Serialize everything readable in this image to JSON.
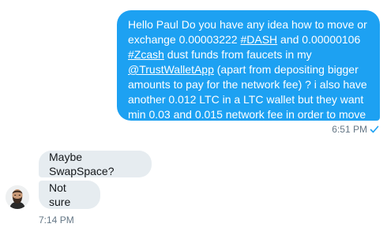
{
  "conversation": {
    "outgoing": {
      "segments": [
        {
          "text": "Hello Paul Do you have any idea how to move or exchange  0.00003222 ",
          "link": false
        },
        {
          "text": "#DASH",
          "link": true
        },
        {
          "text": " and 0.00000106 ",
          "link": false
        },
        {
          "text": "#Zcash",
          "link": true
        },
        {
          "text": " dust funds from faucets in  my ",
          "link": false
        },
        {
          "text": "@TrustWalletApp",
          "link": true
        },
        {
          "text": " (apart from depositing bigger amounts to pay for the network fee) ? i also have another 0.012 LTC in a LTC wallet but they want min 0.03 and 0.015 network fee in order to move them",
          "link": false
        }
      ],
      "time": "6:51 PM",
      "status_icon": "check-icon"
    },
    "incoming": [
      {
        "text": "Maybe SwapSpace?"
      },
      {
        "text": "Not sure"
      }
    ],
    "incoming_time": "7:14 PM"
  },
  "colors": {
    "outgoing_bubble": "#1da1f2",
    "incoming_bubble": "#e6ecf0",
    "meta_text": "#657786",
    "check": "#1da1f2"
  }
}
